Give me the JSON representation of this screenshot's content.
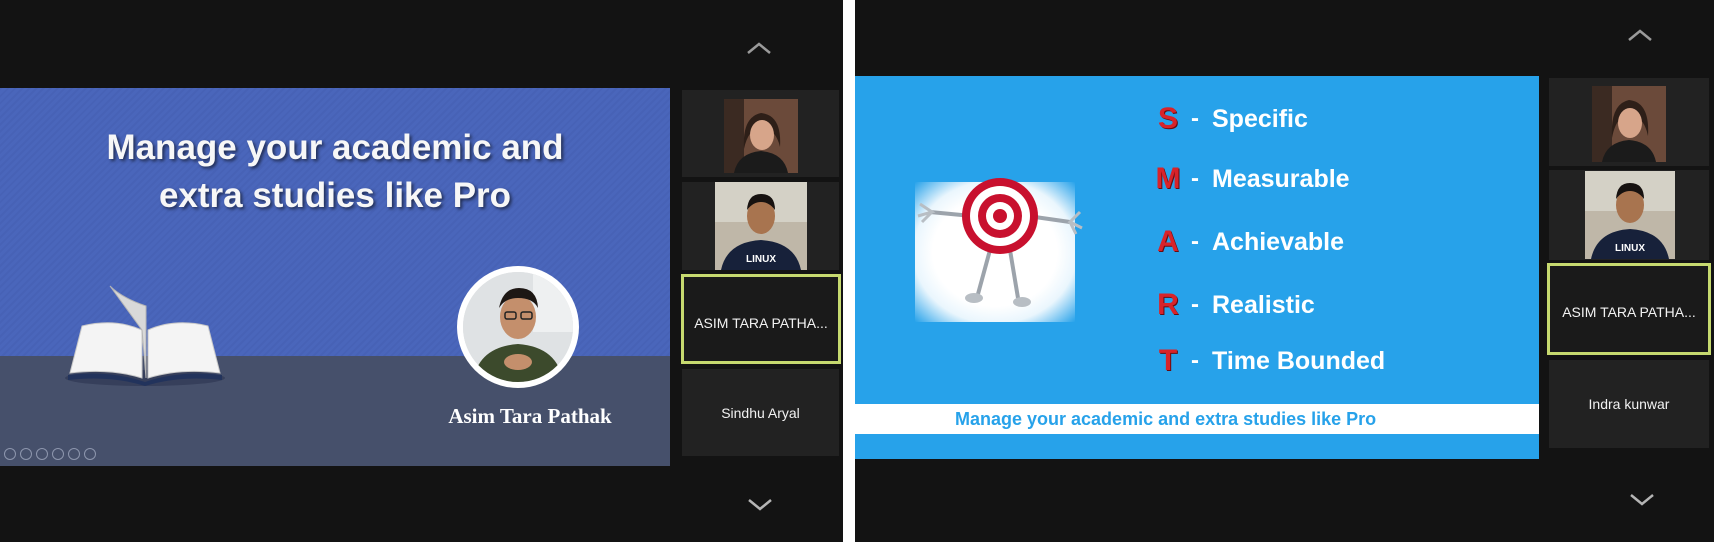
{
  "left": {
    "slide": {
      "title": "Manage your academic and\nextra studies like Pro",
      "presenter_name": "Asim Tara Pathak"
    },
    "participants": [
      {
        "name": ""
      },
      {
        "name": ""
      },
      {
        "name": "ASIM TARA PATHA..."
      },
      {
        "name": "Sindhu Aryal"
      }
    ]
  },
  "right": {
    "slide": {
      "smart": [
        {
          "letter": "S",
          "word": "Specific"
        },
        {
          "letter": "M",
          "word": "Measurable"
        },
        {
          "letter": "A",
          "word": "Achievable"
        },
        {
          "letter": "R",
          "word": "Realistic"
        },
        {
          "letter": "T",
          "word": "Time Bounded"
        }
      ],
      "dash": "-",
      "banner": "Manage your academic and extra studies like Pro"
    },
    "participants": [
      {
        "name": ""
      },
      {
        "name": ""
      },
      {
        "name": "ASIM TARA PATHA..."
      },
      {
        "name": "Indra kunwar"
      }
    ]
  },
  "shirt_text": "LINUX",
  "colors": {
    "active_border": "#c6d96f",
    "slide_left_bg": "#4a66bb",
    "slide_right_bg": "#27a2ea",
    "smart_letter": "#d8232a"
  },
  "icons": [
    "chevron-up-icon",
    "chevron-down-icon",
    "book-icon",
    "target-icon"
  ]
}
